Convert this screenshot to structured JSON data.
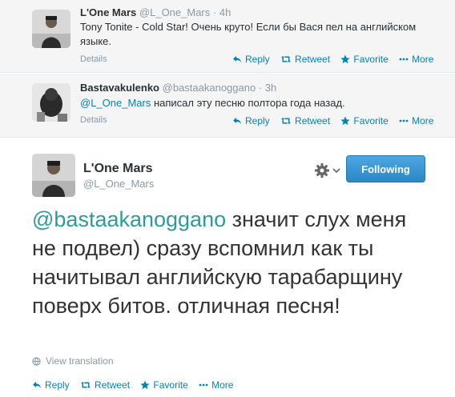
{
  "tweets": [
    {
      "fullname": "L'One Mars",
      "screenname": "@L_One_Mars",
      "time": "4h",
      "text": "Tony Tonite - Cold Star! Очень круто! Если бы Вася пел на английском языке.",
      "mention": "",
      "details": "Details"
    },
    {
      "fullname": "Bastavakulenko",
      "screenname": "@bastaakanoggano",
      "time": "3h",
      "mention": "@L_One_Mars",
      "text": " написал эту песню полтора года назад.",
      "details": "Details"
    }
  ],
  "actions": {
    "reply": "Reply",
    "retweet": "Retweet",
    "favorite": "Favorite",
    "more": "More"
  },
  "sep": "·",
  "main": {
    "fullname": "L'One Mars",
    "screenname": "@L_One_Mars",
    "follow_label": "Following",
    "mention": "@bastaakanoggano",
    "text": " значит слух меня не подвел) сразу вспомнил как ты начитывал английскую тарабарщину поверх битов. отличная песня!",
    "view_translation": "View translation"
  },
  "colors": {
    "link": "#0084b4",
    "accent": "#2b87c8"
  },
  "icons": [
    "reply-icon",
    "retweet-icon",
    "favorite-icon",
    "more-icon",
    "gear-icon",
    "globe-icon"
  ]
}
